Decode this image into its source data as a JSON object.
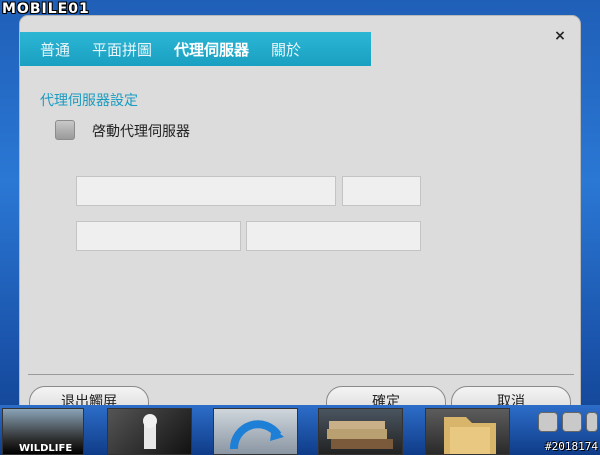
{
  "watermark": {
    "logo": "MOBILE01",
    "id": "#2018174"
  },
  "dialog": {
    "tabs": [
      {
        "label": "普通"
      },
      {
        "label": "平面拼圖"
      },
      {
        "label": "代理伺服器"
      },
      {
        "label": "關於"
      }
    ],
    "active_tab_index": 2,
    "close_label": "×",
    "section_title": "代理伺服器設定",
    "enable_proxy": {
      "label": "啓動代理伺服器",
      "checked": false
    },
    "fields": {
      "proxy_address": "",
      "proxy_port": "",
      "username": "",
      "password": ""
    },
    "buttons": {
      "exit_fullscreen": "退出觸屏",
      "ok": "確定",
      "cancel": "取消"
    }
  },
  "taskbar": {
    "thumbs": [
      {
        "name": "wildlife",
        "label": "WILDLIFE"
      },
      {
        "name": "chess"
      },
      {
        "name": "sync"
      },
      {
        "name": "books"
      },
      {
        "name": "folder"
      }
    ]
  },
  "colors": {
    "tab_accent": "#1aa0c2",
    "section_title": "#1a9cc0",
    "dialog_bg": "#dcdcdc",
    "desktop": "#2a78d4"
  }
}
